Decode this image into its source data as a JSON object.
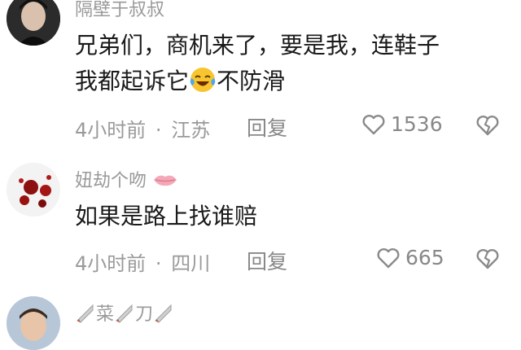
{
  "comments": [
    {
      "username": "隔壁于叔叔",
      "text_line1": "兄弟们，商机来了，要是我，连鞋子",
      "text_line2_before": "我都起诉它",
      "text_line2_after": "不防滑",
      "emoji": "crying-laughing-emoji",
      "time": "4小时前",
      "separator": "·",
      "location": "江苏",
      "reply_label": "回复",
      "likes": "1536"
    },
    {
      "username": "妞劫个吻",
      "username_emoji": "lips-emoji",
      "text": "如果是路上找谁赔",
      "time": "4小时前",
      "separator": "·",
      "location": "四川",
      "reply_label": "回复",
      "likes": "665"
    },
    {
      "username_main_1": "菜",
      "username_main_2": "刀",
      "username_icons": [
        "knife-emoji",
        "knife-emoji",
        "knife-emoji"
      ]
    }
  ],
  "colors": {
    "text": "#1a1a1a",
    "muted": "#9a9a9a",
    "background": "#ffffff"
  }
}
